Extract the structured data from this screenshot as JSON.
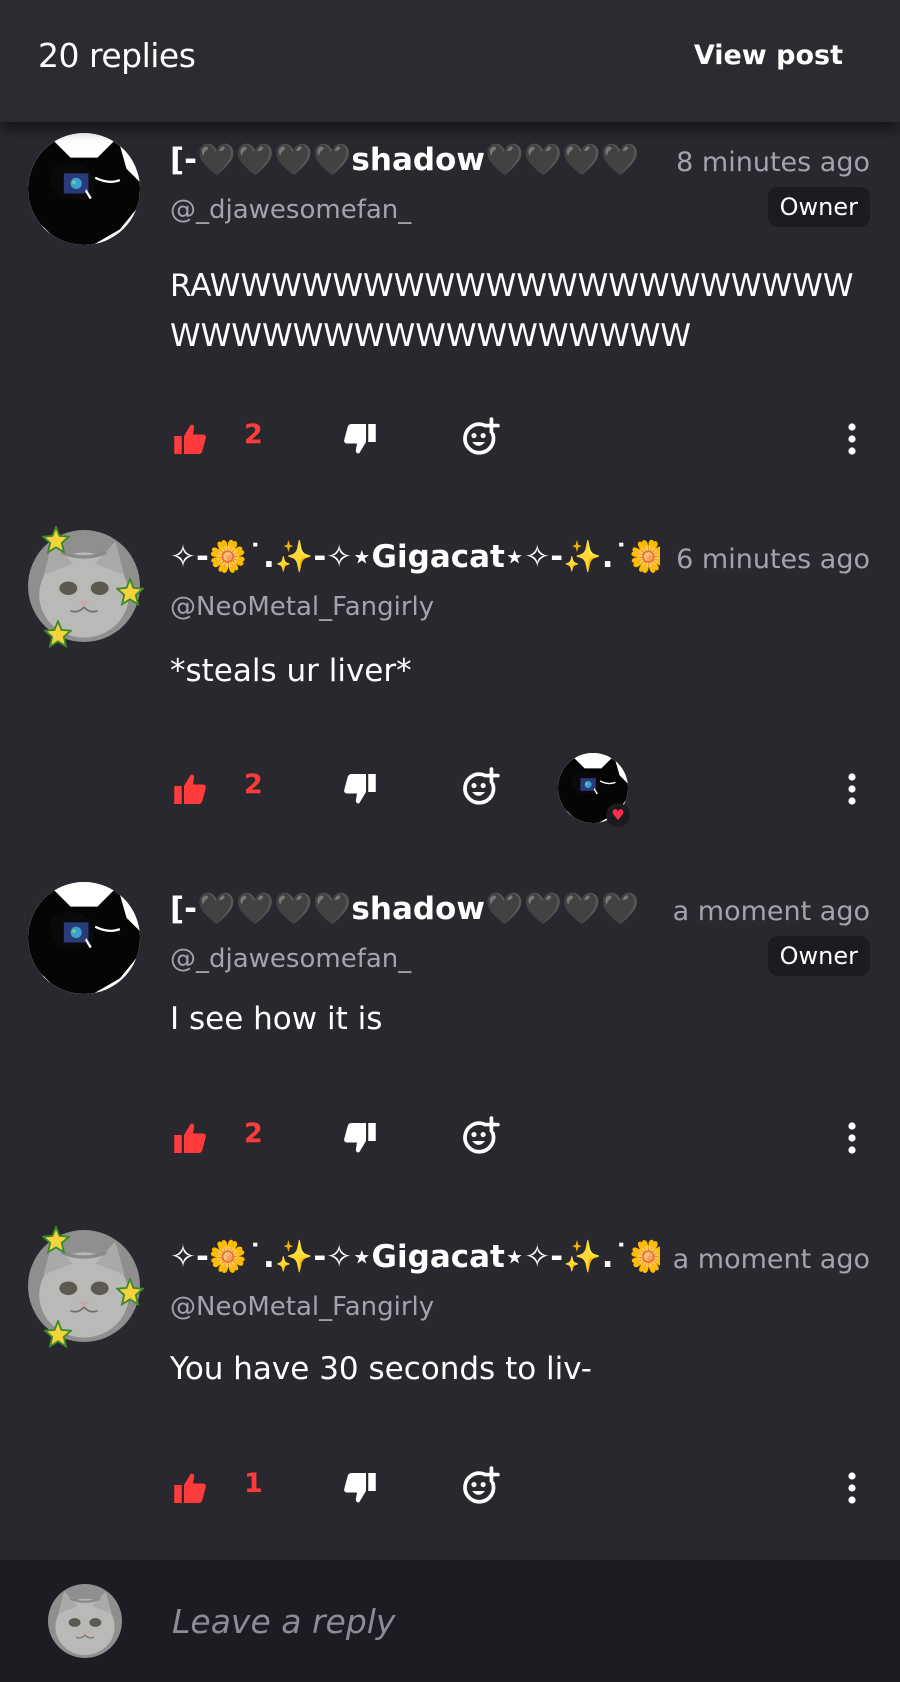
{
  "header": {
    "replies_count": "20 replies",
    "view_post_label": "View post"
  },
  "comments": [
    {
      "name": "[-🖤🖤🖤🖤shadow🖤🖤🖤🖤",
      "handle": "@_djawesomefan_",
      "time": "8 minutes ago",
      "badge": "Owner",
      "text": "RAWWWWWWWWWWWWWWWWWWWWWWWWWWWWWWWWWWWWWW",
      "likes": "2",
      "avatar": "black-cat-avatar"
    },
    {
      "name": "✧-🌼˙.✨-✧⋆Gigacat⋆✧-✨.˙🌼",
      "handle": "@NeoMetal_Fangirly",
      "time": "6 minutes ago",
      "text": "*steals ur liver*",
      "likes": "2",
      "avatar": "gray-cat-avatar",
      "reaction": "heart"
    },
    {
      "name": "[-🖤🖤🖤🖤shadow🖤🖤🖤🖤",
      "handle": "@_djawesomefan_",
      "time": "a moment ago",
      "badge": "Owner",
      "text": "I see how it is",
      "likes": "2",
      "avatar": "black-cat-avatar"
    },
    {
      "name": "✧-🌼˙.✨-✧⋆Gigacat⋆✧-✨.˙🌼",
      "handle": "@NeoMetal_Fangirly",
      "time": "a moment ago",
      "text": "You have 30 seconds to liv-",
      "likes": "1",
      "avatar": "gray-cat-avatar"
    }
  ],
  "footer": {
    "reply_placeholder": "Leave a reply"
  },
  "colors": {
    "background": "#29282e",
    "like": "#ff3b3b",
    "muted_text": "#a4a3ab",
    "badge_bg": "#1c1b20",
    "footer_bg": "#1d1c23"
  }
}
